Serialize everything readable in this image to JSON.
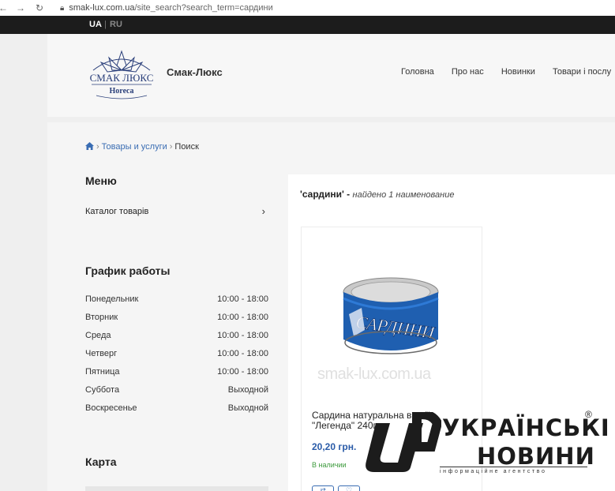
{
  "browser": {
    "url_host": "smak-lux.com.ua",
    "url_rest": "/site_search?search_term=сардини"
  },
  "langbar": {
    "ua": "UA",
    "sep": "|",
    "ru": "RU"
  },
  "header": {
    "logo_text": "СМАК ЛЮКС",
    "logo_sub": "Horeca",
    "brand": "Смак-Люкс",
    "nav": [
      "Головна",
      "Про нас",
      "Новинки",
      "Товари і послу"
    ]
  },
  "breadcrumb": {
    "items": [
      "Товары и услуги"
    ],
    "current": "Поиск",
    "arrow": "›"
  },
  "sidebar": {
    "menu_title": "Меню",
    "catalog": "Каталог товарів",
    "chevron": "›",
    "hours_title": "График работы",
    "hours": [
      {
        "day": "Понедельник",
        "time": "10:00 - 18:00"
      },
      {
        "day": "Вторник",
        "time": "10:00 - 18:00"
      },
      {
        "day": "Среда",
        "time": "10:00 - 18:00"
      },
      {
        "day": "Четверг",
        "time": "10:00 - 18:00"
      },
      {
        "day": "Пятница",
        "time": "10:00 - 18:00"
      },
      {
        "day": "Суббота",
        "time": "Выходной"
      },
      {
        "day": "Воскресенье",
        "time": "Выходной"
      }
    ],
    "map_title": "Карта"
  },
  "results": {
    "query": "'сардини' -",
    "found": "найдено 1 наименование",
    "product": {
      "name": "Сардина натуральна в олії \"Легенда\" 240г",
      "price": "20,20 грн.",
      "stock": "В наличии",
      "watermark": "smak-lux.com.ua",
      "can_label": "САРДИНИ"
    }
  },
  "news_watermark": {
    "line1": "УКРАЇНСЬКІ",
    "line2": "НОВИНИ",
    "reg": "®",
    "sub": "інформаційне агентство"
  },
  "colors": {
    "link": "#3a6db3",
    "price": "#2a5ba8",
    "stock": "#3c9a3c",
    "langbar": "#1c1c1c"
  }
}
